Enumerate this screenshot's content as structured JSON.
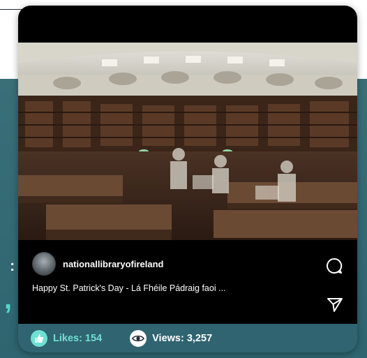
{
  "post": {
    "username": "nationallibraryofireland",
    "caption": "Happy St. Patrick's Day - Lá Fhéile Pádraig faoi ...",
    "photo_icon": "reading-room-photo"
  },
  "stats": {
    "likes": "Likes: 154",
    "views": "Views: 3,257"
  },
  "background": {
    "colon": ":",
    "comma": ","
  },
  "colors": {
    "teal_panel": "#2f6470",
    "likes_accent": "#6fe0d3",
    "card_background": "#000000"
  },
  "icons": {
    "comment": "comment-icon",
    "share": "share-icon",
    "likes": "thumbs-up-icon",
    "views": "eye-icon"
  }
}
